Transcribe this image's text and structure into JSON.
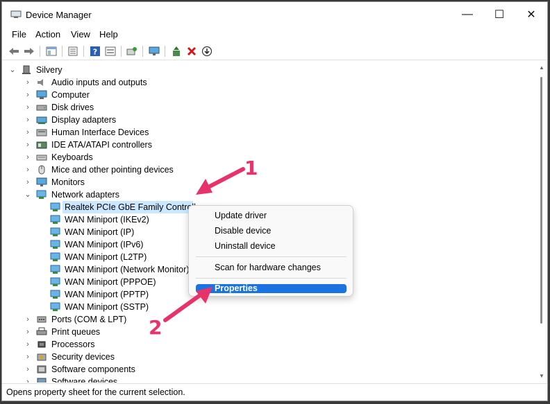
{
  "window": {
    "title": "Device Manager",
    "controls": {
      "minimize": "—",
      "maximize": "☐",
      "close": "✕"
    }
  },
  "menu": [
    "File",
    "Action",
    "View",
    "Help"
  ],
  "toolbar_icons": [
    "back-icon",
    "forward-icon",
    "properties-console-icon",
    "device-list-icon",
    "help-icon",
    "show-hidden-icon",
    "scan-hardware-icon",
    "monitor-icon",
    "update-driver-icon",
    "uninstall-icon",
    "disable-icon"
  ],
  "tree": {
    "root": "Silvery",
    "categories": [
      {
        "label": "Audio inputs and outputs",
        "icon": "speaker-icon"
      },
      {
        "label": "Computer",
        "icon": "computer-icon"
      },
      {
        "label": "Disk drives",
        "icon": "disk-icon"
      },
      {
        "label": "Display adapters",
        "icon": "display-adapter-icon"
      },
      {
        "label": "Human Interface Devices",
        "icon": "hid-icon"
      },
      {
        "label": "IDE ATA/ATAPI controllers",
        "icon": "ide-icon"
      },
      {
        "label": "Keyboards",
        "icon": "keyboard-icon"
      },
      {
        "label": "Mice and other pointing devices",
        "icon": "mouse-icon"
      },
      {
        "label": "Monitors",
        "icon": "monitor-icon"
      },
      {
        "label": "Network adapters",
        "icon": "network-icon",
        "expanded": true
      }
    ],
    "network_children": [
      "Realtek PCIe GbE Family Controller",
      "WAN Miniport (IKEv2)",
      "WAN Miniport (IP)",
      "WAN Miniport (IPv6)",
      "WAN Miniport (L2TP)",
      "WAN Miniport (Network Monitor)",
      "WAN Miniport (PPPOE)",
      "WAN Miniport (PPTP)",
      "WAN Miniport (SSTP)"
    ],
    "more_categories": [
      {
        "label": "Ports (COM & LPT)",
        "icon": "port-icon"
      },
      {
        "label": "Print queues",
        "icon": "printer-icon"
      },
      {
        "label": "Processors",
        "icon": "processor-icon"
      },
      {
        "label": "Security devices",
        "icon": "security-icon"
      },
      {
        "label": "Software components",
        "icon": "software-component-icon"
      },
      {
        "label": "Software devices",
        "icon": "software-device-icon"
      }
    ]
  },
  "context_menu": {
    "items": [
      "Update driver",
      "Disable device",
      "Uninstall device"
    ],
    "scan": "Scan for hardware changes",
    "properties": "Properties"
  },
  "annotations": {
    "one": "1",
    "two": "2",
    "color": "#e8336a"
  },
  "status": "Opens property sheet for the current selection.",
  "colors": {
    "selection": "#cce8ff",
    "menu_highlight": "#1a73e0"
  }
}
